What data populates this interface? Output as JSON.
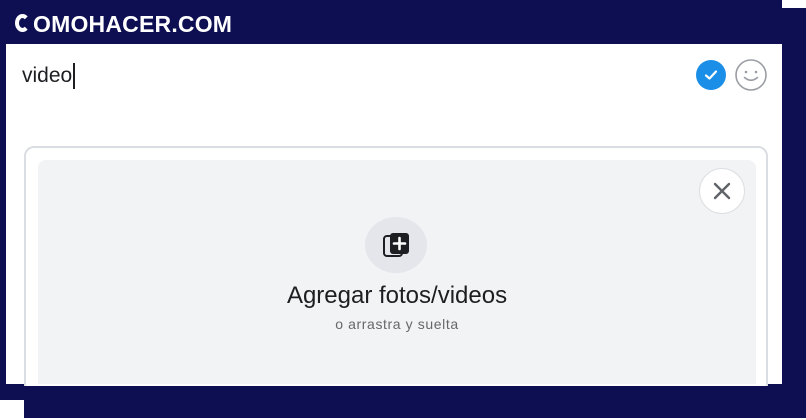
{
  "brand": {
    "logo_text": "OMOHACER.COM",
    "logo_full": "COMOHACER.COM"
  },
  "composer": {
    "text_value": "video",
    "check_icon": "check-circle-icon",
    "emoji_icon": "smiley-icon"
  },
  "upload": {
    "title": "Agregar fotos/videos",
    "subtitle": "o arrastra y suelta",
    "add_icon": "add-photo-icon",
    "close_icon": "close-icon"
  },
  "colors": {
    "frame": "#0d0f52",
    "accent": "#1b8fe8",
    "upload_bg": "#f2f3f5"
  }
}
